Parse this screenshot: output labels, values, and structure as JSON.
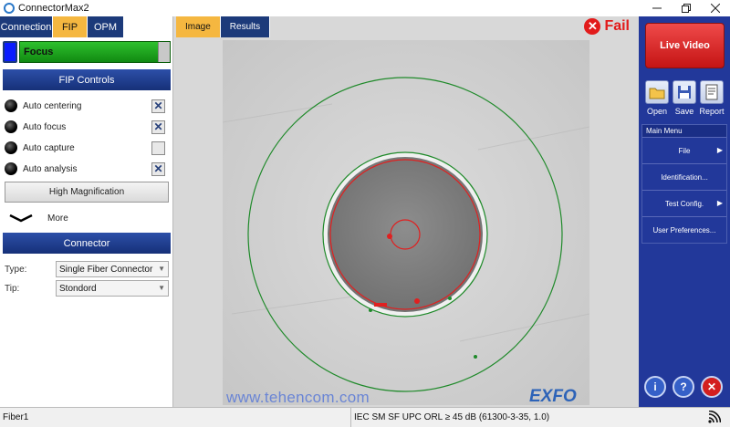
{
  "window": {
    "title": "ConnectorMax2",
    "controls": [
      "minimize",
      "restore",
      "close"
    ]
  },
  "top_tabs": [
    {
      "label": "Connection",
      "active": false
    },
    {
      "label": "FIP",
      "active": true
    },
    {
      "label": "OPM",
      "active": false
    }
  ],
  "focus": {
    "label": "Focus",
    "level": 0.92
  },
  "fip_controls": {
    "header": "FIP Controls",
    "items": [
      {
        "label": "Auto centering",
        "checked": true
      },
      {
        "label": "Auto focus",
        "checked": true
      },
      {
        "label": "Auto capture",
        "checked": false
      },
      {
        "label": "Auto analysis",
        "checked": true
      }
    ],
    "magnification_button": "High Magnification",
    "more_label": "More"
  },
  "connector": {
    "header": "Connector",
    "type_label": "Type:",
    "type_value": "Single Fiber Connector",
    "tip_label": "Tip:",
    "tip_value": "Stondord"
  },
  "image_tabs": [
    {
      "label": "Image",
      "active": true
    },
    {
      "label": "Results",
      "active": false
    }
  ],
  "result": {
    "label": "Fail",
    "color": "#e21b1b"
  },
  "watermark": "www.tehencom.com",
  "brand": "EXFO",
  "right_panel": {
    "live_video": "Live Video",
    "tools": [
      {
        "label": "Open",
        "icon": "folder-open-icon"
      },
      {
        "label": "Save",
        "icon": "floppy-disk-icon"
      },
      {
        "label": "Report",
        "icon": "report-icon"
      }
    ],
    "menu_title": "Main Menu",
    "menu_items": [
      {
        "label": "File",
        "submenu": true
      },
      {
        "label": "Identification...",
        "submenu": false
      },
      {
        "label": "Test Config.",
        "submenu": true
      },
      {
        "label": "User Preferences...",
        "submenu": false
      }
    ]
  },
  "status": {
    "fiber": "Fiber1",
    "standard": "IEC SM SF UPC ORL ≥ 45 dB (61300-3-35, 1.0)"
  },
  "colors": {
    "tab_active": "#f5b740",
    "tab_inactive": "#1c3a7a",
    "panel_blue": "#22389a",
    "focus_green": "#1ea51e",
    "fail_red": "#e21b1b"
  }
}
